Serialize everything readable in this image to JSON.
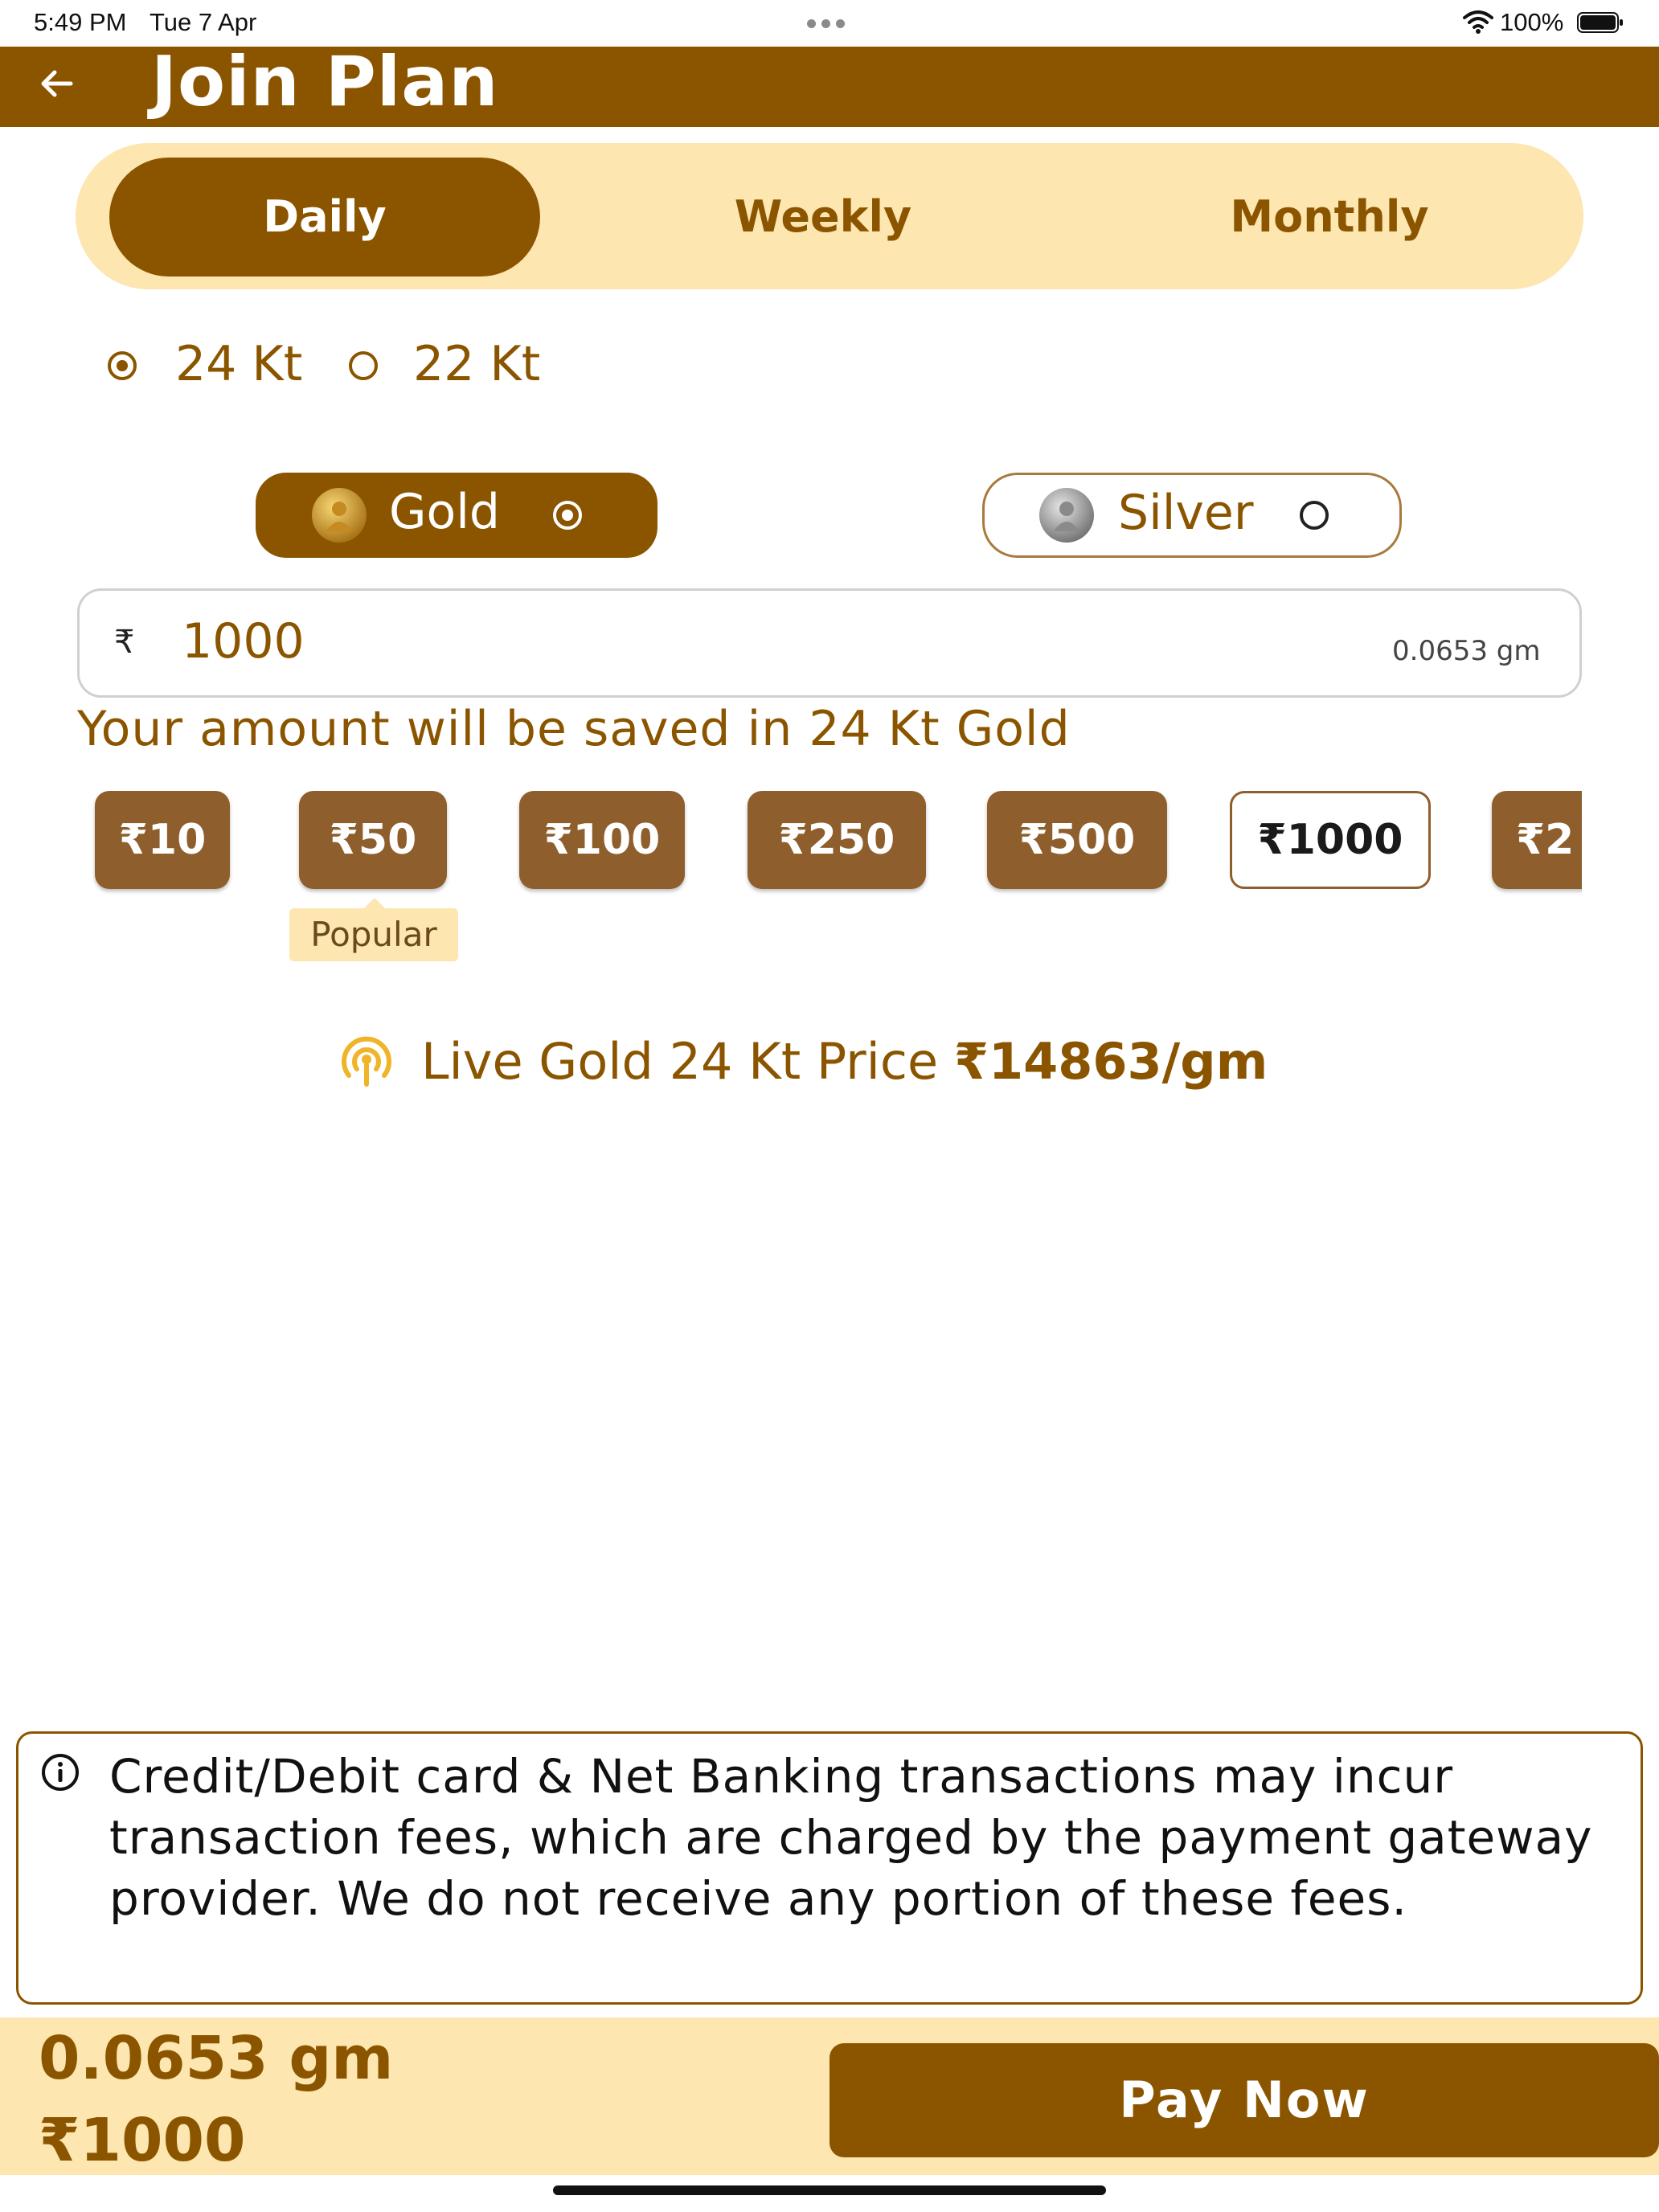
{
  "status_bar": {
    "time": "5:49 PM",
    "date": "Tue 7 Apr",
    "battery": "100%"
  },
  "header": {
    "title": "Join Plan",
    "back_icon": "back-arrow-icon"
  },
  "tabs": [
    {
      "label": "Daily",
      "selected": true
    },
    {
      "label": "Weekly",
      "selected": false
    },
    {
      "label": "Monthly",
      "selected": false
    }
  ],
  "karat_options": [
    {
      "label": "24 Kt",
      "selected": true
    },
    {
      "label": "22 Kt",
      "selected": false
    }
  ],
  "metal_options": [
    {
      "label": "Gold",
      "selected": true
    },
    {
      "label": "Silver",
      "selected": false
    }
  ],
  "amount": {
    "currency_symbol": "₹",
    "value": "1000",
    "grams": "0.0653 gm"
  },
  "save_note": "Your amount will be saved in 24 Kt Gold",
  "quick_amounts": [
    {
      "label": "₹10",
      "selected": false
    },
    {
      "label": "₹50",
      "selected": false
    },
    {
      "label": "₹100",
      "selected": false
    },
    {
      "label": "₹250",
      "selected": false
    },
    {
      "label": "₹500",
      "selected": false
    },
    {
      "label": "₹1000",
      "selected": true
    },
    {
      "label": "₹2",
      "selected": false
    }
  ],
  "popular_tag": "Popular",
  "live_price": {
    "label": "Live Gold 24 Kt Price",
    "value": "₹14863/gm"
  },
  "info_note": "Credit/Debit card & Net Banking transactions may incur transaction fees, which are charged by the payment gateway provider. We do not receive any portion of these fees.",
  "footer": {
    "grams": "0.0653 gm",
    "amount": "₹1000",
    "pay_label": "Pay Now"
  },
  "colors": {
    "brand": "#8b5500",
    "accent_light": "#fde6b0",
    "chip": "#8e5f2c"
  }
}
